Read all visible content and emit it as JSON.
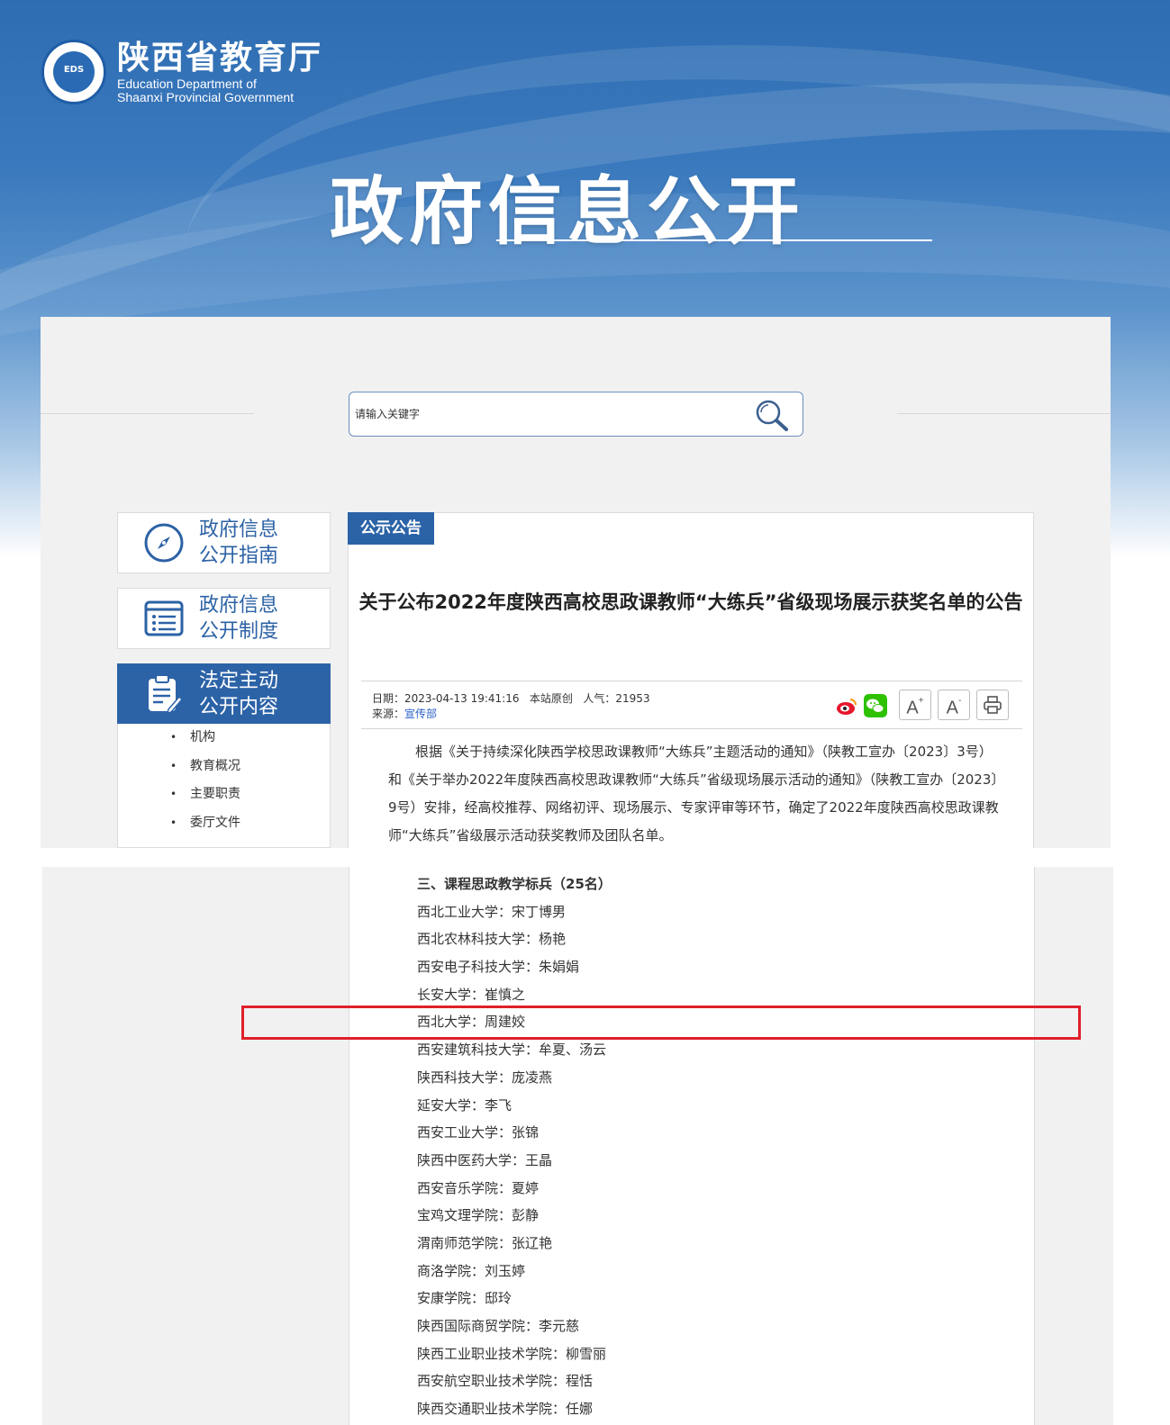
{
  "header": {
    "org_cn": "陕西省教育厅",
    "org_en_line1": "Education Department of",
    "org_en_line2": "Shaanxi Provincial Government",
    "logo_abbr": "EDS",
    "banner_title": "政府信息公开"
  },
  "search": {
    "placeholder": "请输入关键字",
    "icon": "search-icon"
  },
  "sidebar": {
    "cards": [
      {
        "label": "政府信息公开指南",
        "icon": "compass-icon"
      },
      {
        "label": "政府信息公开制度",
        "icon": "list-icon"
      },
      {
        "label": "法定主动公开内容",
        "icon": "clipboard-edit-icon",
        "active": true
      }
    ],
    "items": [
      "机构",
      "教育概况",
      "主要职责",
      "委厅文件"
    ]
  },
  "article": {
    "category_tag": "公示公告",
    "title": "关于公布2022年度陕西高校思政课教师“大练兵”省级现场展示获奖名单的公告",
    "meta": {
      "date_label": "日期：",
      "date": "2023-04-13 19:41:16",
      "origin": "本站原创",
      "views_label": "人气：",
      "views": "21953",
      "source_label": "来源：",
      "source": "宣传部"
    },
    "tools": {
      "weibo": "weibo-icon",
      "wechat": "wechat-icon",
      "font_larger": "A",
      "font_smaller": "A",
      "print": "print-icon"
    },
    "intro": "根据《关于持续深化陕西学校思政课教师“大练兵”主题活动的通知》（陕教工宣办〔2023〕3号）和《关于举办2022年度陕西高校思政课教师“大练兵”省级现场展示活动的通知》（陕教工宣办〔2023〕9号）安排，经高校推荐、网络初评、现场展示、专家评审等环节，确定了2022年度陕西高校思政课教师“大练兵”省级展示活动获奖教师及团队名单。",
    "section_title": "三、课程思政教学标兵（25名）",
    "winners": [
      "西北工业大学：宋丁博男",
      "西北农林科技大学：杨艳",
      "西安电子科技大学：朱娟娟",
      "长安大学：崔慎之",
      "西北大学：周建姣",
      "西安建筑科技大学：牟夏、汤云",
      "陕西科技大学：庞凌燕",
      "延安大学：李飞",
      "西安工业大学：张锦",
      "陕西中医药大学：王晶",
      "西安音乐学院：夏婷",
      "宝鸡文理学院：彭静",
      "渭南师范学院：张辽艳",
      "商洛学院：刘玉婷",
      "安康学院：邸玲",
      "陕西国际商贸学院：李元慈",
      "陕西工业职业技术学院：柳雪丽",
      "西安航空职业技术学院：程恬",
      "陕西交通职业技术学院：任娜"
    ]
  }
}
